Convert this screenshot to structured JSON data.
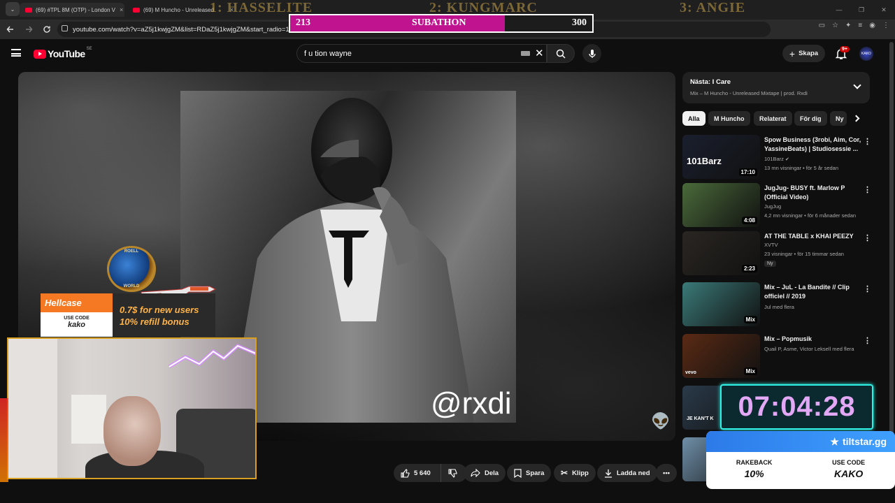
{
  "browser": {
    "tabs": [
      {
        "title": "(69) #TPL 8M (OTP) - London V",
        "close": "×"
      },
      {
        "title": "(69) M Huncho - Unreleased",
        "close": "×"
      }
    ],
    "window_controls": [
      "—",
      "❐",
      "✕"
    ],
    "url": "youtube.com/watch?v=aZ5j1kwjgZM&list=RDaZ5j1kwjgZM&start_radio=1"
  },
  "stream_overlay": {
    "leaderboard": [
      "1: HASSELITE",
      "2: KUNGMARC",
      "3: ANGIE"
    ],
    "subathon": {
      "current": "213",
      "label": "SUBATHON",
      "target": "300",
      "progress": 0.71
    },
    "timer": "07:04:28",
    "hellcase": {
      "brand": "Hellcase",
      "use_code_label": "USE CODE",
      "code": "kako",
      "line1": "0.7$ for new users",
      "line2": "10% refill bonus"
    },
    "tiltstar": {
      "brand": "tiltstar.gg",
      "rakeback_label": "RAKEBACK",
      "rakeback_value": "10%",
      "use_code_label": "USE CODE",
      "code": "KAKO"
    },
    "globe_text": [
      "ROELL",
      "WORLD"
    ]
  },
  "youtube": {
    "logo": "YouTube",
    "region": "SE",
    "search_value": "f u tion wayne",
    "create_label": "Skapa",
    "notifications_badge": "9+",
    "avatar_text": "KAKO",
    "video": {
      "watermark": "@rxdi"
    },
    "actions": {
      "likes": "5 640",
      "share": "Dela",
      "save": "Spara",
      "clip": "Klipp",
      "download": "Ladda ned",
      "more": "•••"
    },
    "up_next": {
      "title": "Nästa: I Care",
      "subtitle": "Mix – M Huncho - Unreleased Mixtape | prod. Rxdi"
    },
    "chips": [
      "Alla",
      "M Huncho",
      "Relaterat",
      "För dig",
      "Ny"
    ],
    "recommendations": [
      {
        "title": "Spow Business (3robi, Aim, Cor, YassineBeats) | Studiosessie ...",
        "channel": "101Barz",
        "verified": true,
        "stats": "13 mn visningar • för 5 år sedan",
        "duration": "17:10",
        "thumb_text": "101Barz",
        "thumb_color": "#1a1f2e"
      },
      {
        "title": "JugJug- BUSY ft. Marlow P (Official Video)",
        "channel": "JugJug",
        "stats": "4,2 mn visningar • för 6 månader sedan",
        "duration": "4:08",
        "thumb_text": "",
        "thumb_color": "#4a6a3a"
      },
      {
        "title": "AT THE TABLE x KHAI PEEZY",
        "channel": "XVTV",
        "stats": "23 visningar • för 15 timmar sedan",
        "duration": "2:23",
        "badge": "Ny",
        "thumb_text": "",
        "thumb_color": "#2a2622"
      },
      {
        "title": "Mix – JuL - La Bandite // Clip officiel // 2019",
        "channel": "Jul med flera",
        "duration": "Mix",
        "thumb_text": "",
        "thumb_color": "#3a7a78"
      },
      {
        "title": "Mix – Popmusik",
        "channel": "Quail P, Asme, Victor Leksell med flera",
        "duration": "Mix",
        "thumb_text": "vevo",
        "thumb_color": "#5a2a14"
      },
      {
        "title": "",
        "channel": "",
        "thumb_text": "JE KAN'T K",
        "thumb_color": "#2a3a4a"
      },
      {
        "title": "",
        "channel": "",
        "thumb_text": "",
        "thumb_color": "#6f8fa8"
      }
    ]
  }
}
